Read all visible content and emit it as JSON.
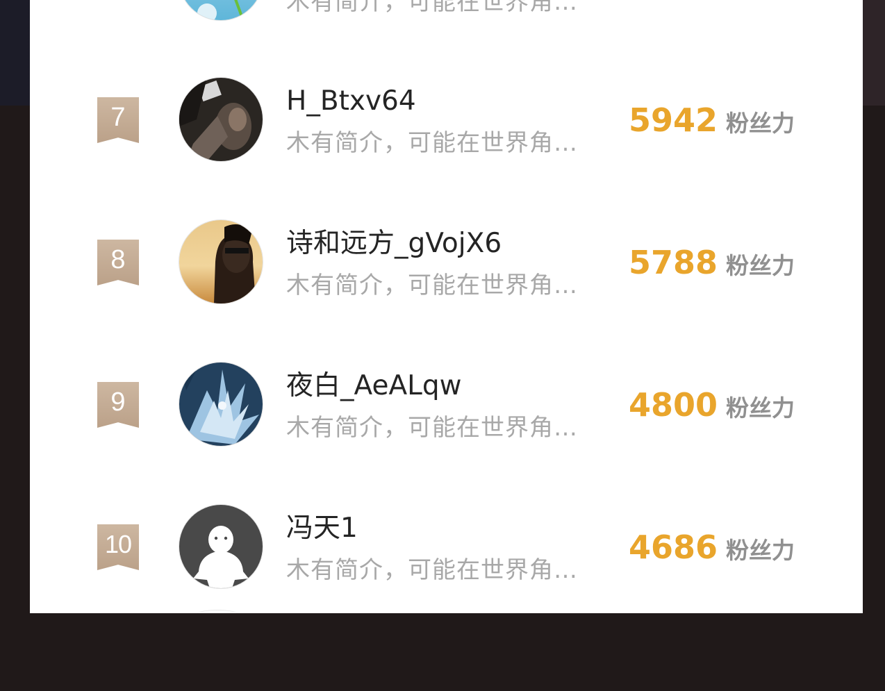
{
  "ranking": {
    "score_unit": "粉丝力",
    "partial_top_bio": "木有简介，可能在世界角…",
    "entries": [
      {
        "rank": "7",
        "username": "H_Btxv64",
        "bio": "木有简介，可能在世界角…",
        "score": "5942",
        "avatar": "photo-avatar-dark"
      },
      {
        "rank": "8",
        "username": "诗和远方_gVojX6",
        "bio": "木有简介，可能在世界角…",
        "score": "5788",
        "avatar": "photo-avatar-sunset"
      },
      {
        "rank": "9",
        "username": "夜白_AeALqw",
        "bio": "木有简介，可能在世界角…",
        "score": "4800",
        "avatar": "photo-avatar-dragon"
      },
      {
        "rank": "10",
        "username": "冯天1",
        "bio": "木有简介，可能在世界角…",
        "score": "4686",
        "avatar": "default-avatar"
      }
    ]
  },
  "colors": {
    "score": "#e9a52c",
    "badge": "#c4ad97",
    "bio": "#a8a8a8",
    "username": "#242424"
  }
}
